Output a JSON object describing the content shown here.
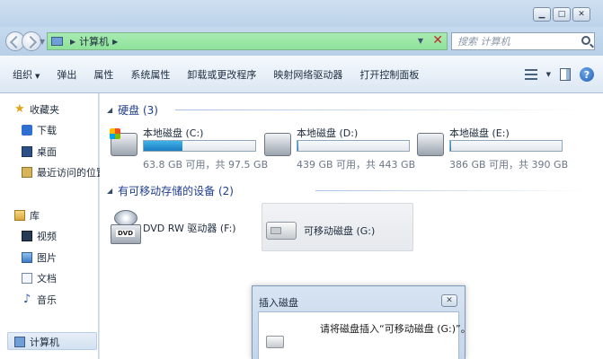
{
  "window": {
    "controls": {
      "minimize": "▁",
      "maximize": "□",
      "close": "✕"
    }
  },
  "address": {
    "location": "计算机",
    "search_placeholder": "搜索 计算机"
  },
  "toolbar": {
    "organize": "组织",
    "eject": "弹出",
    "properties": "属性",
    "system_properties": "系统属性",
    "uninstall": "卸载或更改程序",
    "map_drive": "映射网络驱动器",
    "control_panel": "打开控制面板"
  },
  "nav": {
    "favorites": "收藏夹",
    "downloads": "下载",
    "desktop": "桌面",
    "recent": "最近访问的位置",
    "libraries": "库",
    "videos": "视频",
    "pictures": "图片",
    "documents": "文档",
    "music": "音乐",
    "computer": "计算机"
  },
  "groups": {
    "hard_disks": "硬盘 (3)",
    "removable": "有可移动存储的设备 (2)"
  },
  "drives": [
    {
      "name": "本地磁盘 (C:)",
      "free": "63.8 GB 可用，共 97.5 GB",
      "used_fraction": 0.35
    },
    {
      "name": "本地磁盘 (D:)",
      "free": "439 GB 可用，共 443 GB",
      "used_fraction": 0.01
    },
    {
      "name": "本地磁盘 (E:)",
      "free": "386 GB 可用，共 390 GB",
      "used_fraction": 0.01
    }
  ],
  "devices": {
    "dvd": {
      "name": "DVD RW 驱动器 (F:)",
      "icon_label": "DVD"
    },
    "usb": {
      "name": "可移动磁盘 (G:)"
    }
  },
  "dialog": {
    "title": "插入磁盘",
    "message": "请将磁盘插入“可移动磁盘 (G:)”。",
    "close": "✕"
  },
  "colors": {
    "address_bar": "#8ee29a",
    "progress": "#1b7cc1",
    "group_heading": "#1e3d8f"
  }
}
